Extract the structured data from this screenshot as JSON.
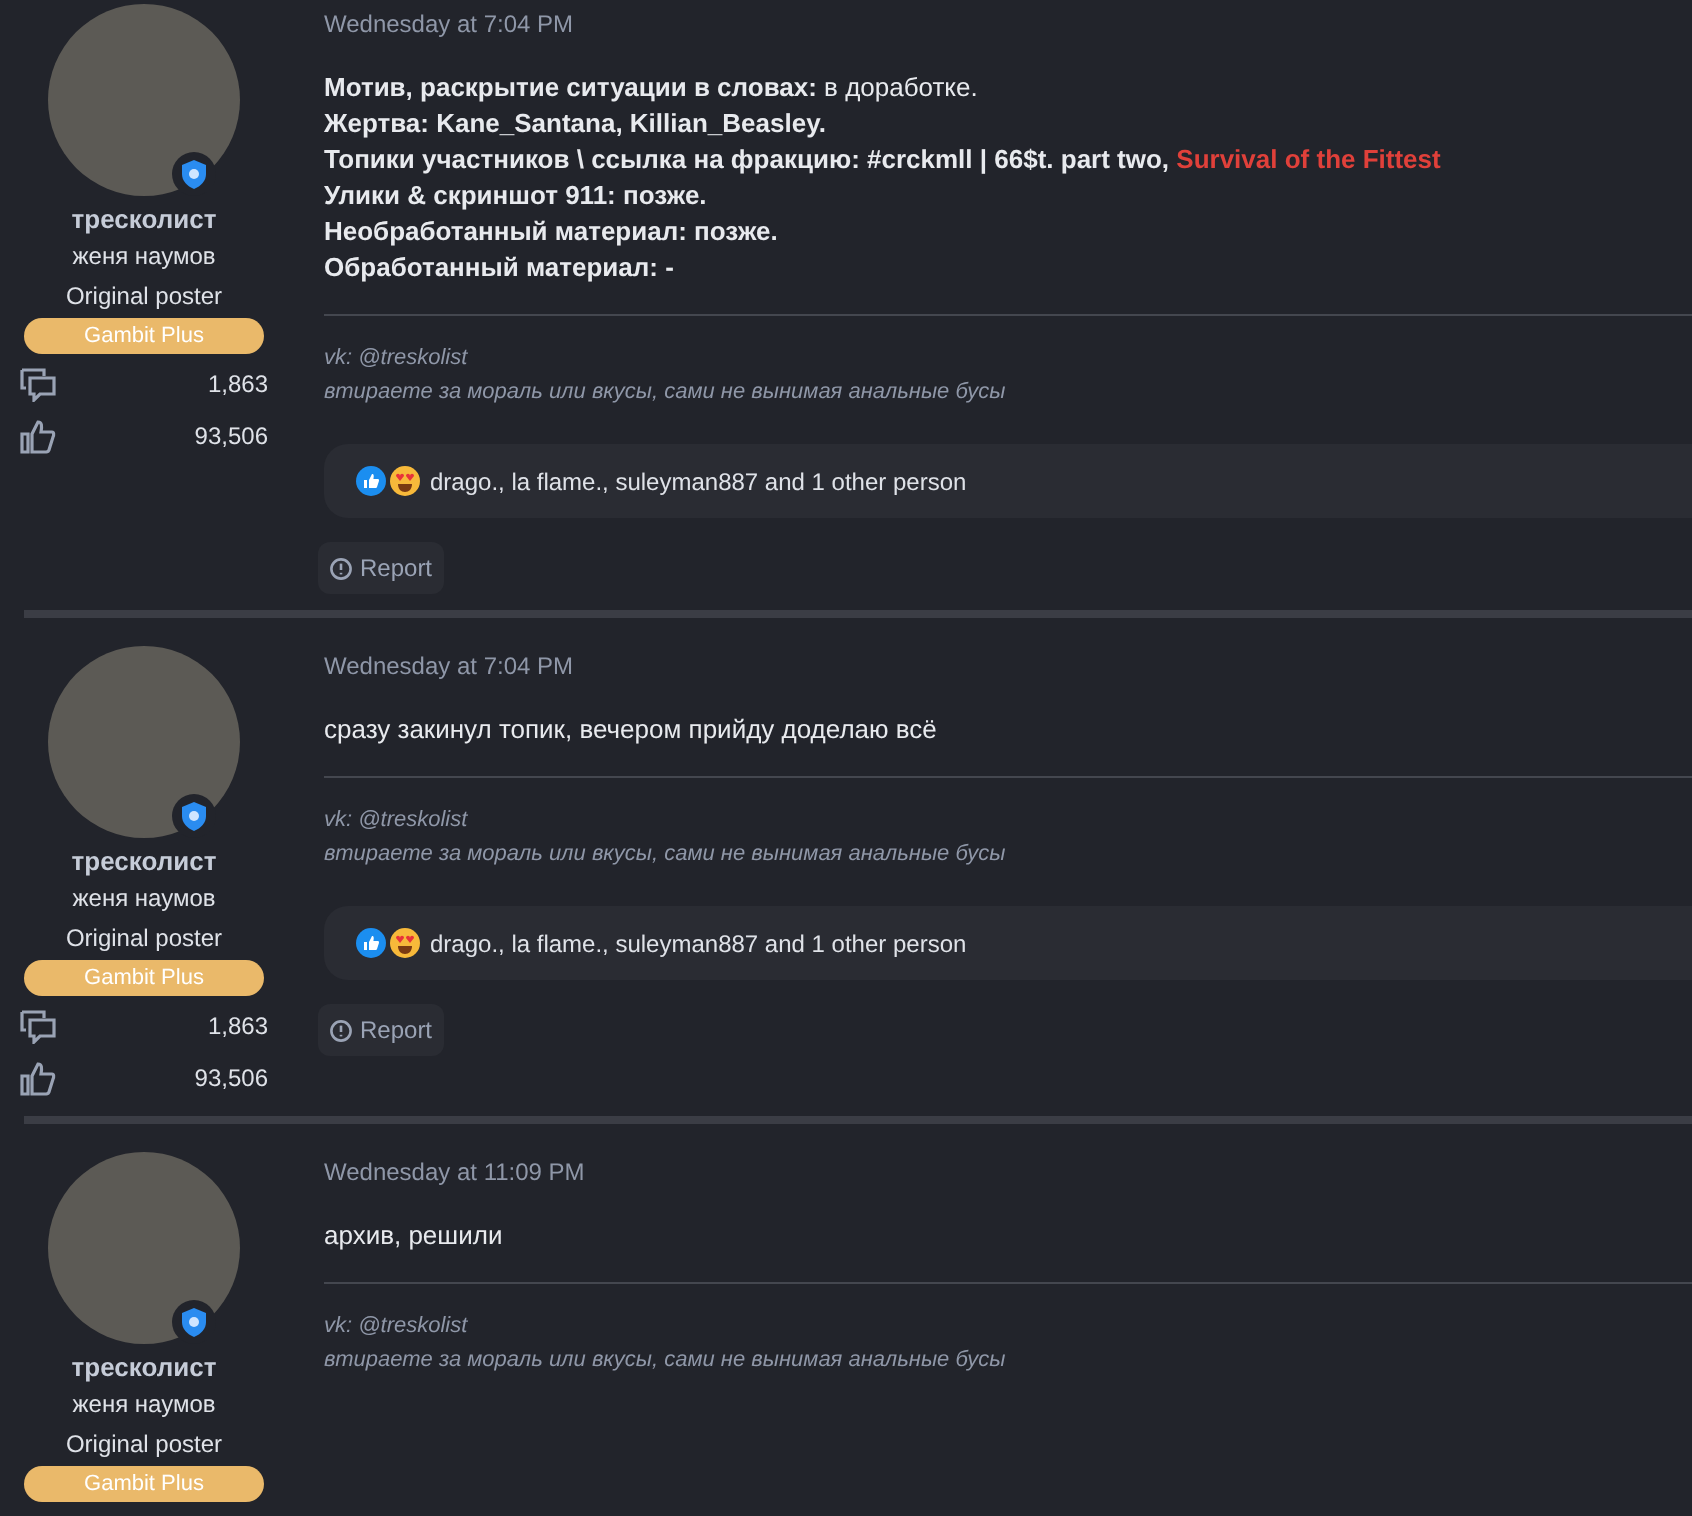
{
  "posts": [
    {
      "date": "Wednesday at 7:04 PM",
      "author": {
        "name": "тресколист",
        "title": "женя наумов",
        "role": "Original poster",
        "badge": "Gambit Plus",
        "stats": [
          {
            "kind": "messages",
            "value": "1,863"
          },
          {
            "kind": "reactions",
            "value": "93,506"
          }
        ]
      },
      "message": [
        [
          {
            "kind": "bold",
            "text": "Мотив, раскрытие ситуации в словах:"
          },
          {
            "kind": "text",
            "text": " в доработке."
          }
        ],
        [
          {
            "kind": "bold",
            "text": "Жертва: Kane_Santana, Killian_Beasley."
          }
        ],
        [
          {
            "kind": "bold",
            "text": "Топики участников \\ ссылка на фракцию: #crckmll | 66$t. part two, "
          },
          {
            "kind": "link",
            "text": "Survival of the Fittest"
          }
        ],
        [
          {
            "kind": "bold",
            "text": "Улики & скриншот 911: позже."
          }
        ],
        [
          {
            "kind": "bold",
            "text": "Необработанный материал: позже."
          }
        ],
        [
          {
            "kind": "bold",
            "text": "Обработанный материал: -"
          }
        ]
      ],
      "signature": [
        "vk: @treskolist",
        "втираете за мораль или вкусы, сами не вынимая анальные бусы"
      ],
      "reactions": "drago., la flame., suleyman887 and 1 other person",
      "actions": [
        "Report"
      ]
    },
    {
      "date": "Wednesday at 7:04 PM",
      "author": {
        "name": "тресколист",
        "title": "женя наумов",
        "role": "Original poster",
        "badge": "Gambit Plus",
        "stats": [
          {
            "kind": "messages",
            "value": "1,863"
          },
          {
            "kind": "reactions",
            "value": "93,506"
          }
        ]
      },
      "message": [
        [
          {
            "kind": "text",
            "text": "сразу закинул топик, вечером прийду доделаю всё"
          }
        ]
      ],
      "signature": [
        "vk: @treskolist",
        "втираете за мораль или вкусы, сами не вынимая анальные бусы"
      ],
      "reactions": "drago., la flame., suleyman887 and 1 other person",
      "actions": [
        "Report"
      ]
    },
    {
      "date": "Wednesday at 11:09 PM",
      "author": {
        "name": "тресколист",
        "title": "женя наумов",
        "role": "Original poster",
        "badge": "Gambit Plus"
      },
      "message": [
        [
          {
            "kind": "text",
            "text": "архив, решили"
          }
        ]
      ],
      "signature": [
        "vk: @treskolist",
        "втираете за мораль или вкусы, сами не вынимая анальные бусы"
      ]
    }
  ]
}
